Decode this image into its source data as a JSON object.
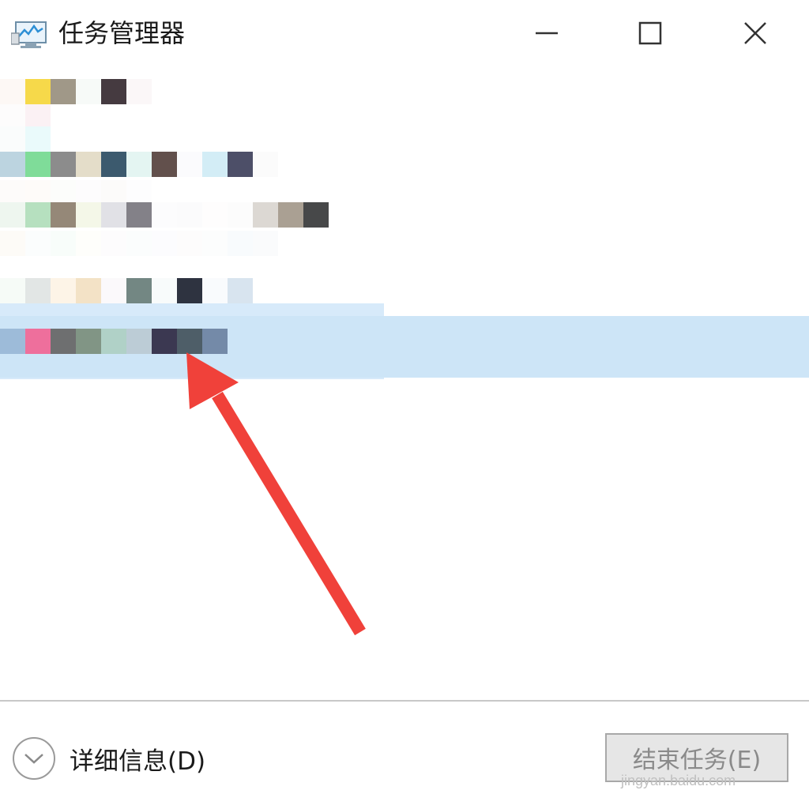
{
  "window": {
    "title": "任务管理器",
    "controls": {
      "minimize": "minimize",
      "maximize": "maximize",
      "close": "close"
    }
  },
  "process_list": {
    "rows": [
      {
        "pixels": [
          "#fdf8f5",
          "#f6d94a",
          "#a09888",
          "#f7faf8",
          "#453a40",
          "#fbf7f8"
        ]
      },
      {
        "pixels": [
          "#fdfcfc",
          "#fbf1f4",
          "#ffffff"
        ]
      },
      {
        "pixels": [
          "#fafcfc",
          "#eafafb"
        ]
      },
      {
        "pixels": [
          "#bcd4e0",
          "#7fdc99",
          "#8c8c8c",
          "#e4ddc9",
          "#3c5a6e",
          "#e4f5f2",
          "#62504c",
          "#fbfbfd",
          "#d3edf6",
          "#4d4f68",
          "#fbfbfb"
        ]
      },
      {
        "pixels": [
          "#fdfbfa",
          "#fefbf9",
          "#fcfdfb",
          "#fdfcfd",
          "#fcfbfa",
          "#fdfdfe"
        ]
      },
      {
        "pixels": [
          "#eef6ef",
          "#b6e0bf",
          "#958878",
          "#f4f7e8",
          "#e1e1e6",
          "#838188",
          "#fcfcfd",
          "#fbfbfc",
          "#fefdfd",
          "#fcfcfc",
          "#dcd8d3",
          "#aaa093",
          "#474849"
        ]
      },
      {
        "pixels": [
          "#fdfbf7",
          "#fbfdfd",
          "#f8fdfa",
          "#fefefb",
          "#fdfcfd",
          "#fbfdfd",
          "#fcfcfe",
          "#fdfcfc",
          "#fcfdfd",
          "#f8fbfd",
          "#fafbfc"
        ]
      },
      {
        "pixels": [
          "#f6fbf7",
          "#e2e6e5",
          "#fdf4e7",
          "#f3e2c6",
          "#fbf9fb",
          "#738783",
          "#f8fbfb",
          "#2e3340",
          "#f9fbfd",
          "#d8e4ef"
        ]
      },
      {
        "pixels": [
          "#9dbbd9",
          "#ee6f9c",
          "#6e6f70",
          "#819585",
          "#b0d1c7",
          "#bcccd6",
          "#3b3851",
          "#4e5e68",
          "#748aa8"
        ],
        "selected": true
      }
    ]
  },
  "annotation": {
    "arrow_color": "#f0413a"
  },
  "footer": {
    "details_label": "详细信息(D)",
    "end_task_label": "结束任务(E)",
    "watermark": "jingyan.baidu.com"
  }
}
